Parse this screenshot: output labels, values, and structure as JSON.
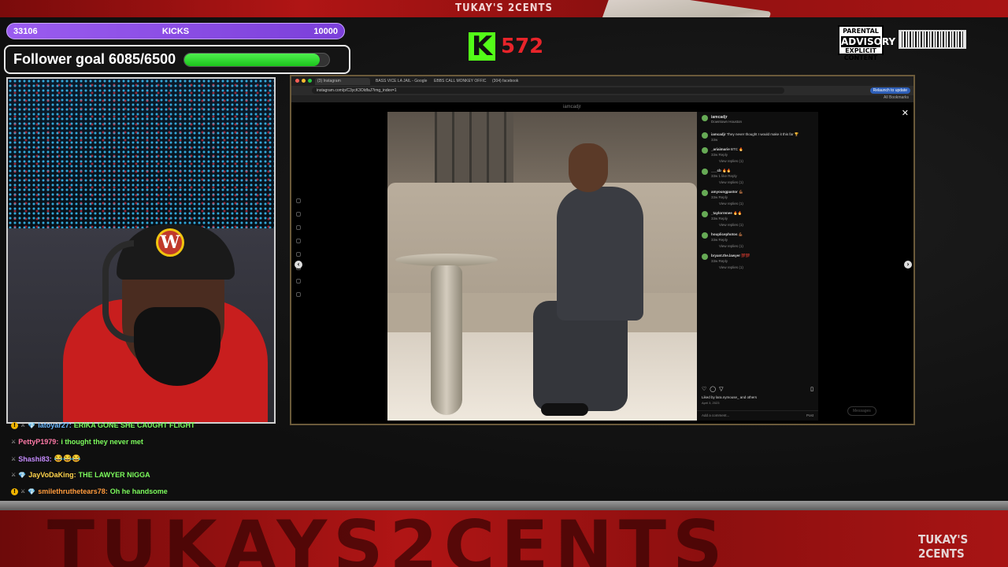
{
  "overlay": {
    "top_title": "TUKAY'S 2CENTS",
    "kicks_bar": {
      "left": "33106",
      "label": "KICKS",
      "right": "10000"
    },
    "follower_goal": {
      "label": "Follower goal 6085/6500",
      "current": 6085,
      "target": 6500
    },
    "kick_count": "572",
    "kick_logo": "K",
    "advisory": {
      "top": "PARENTAL",
      "big": "ADVISORY",
      "bottom": "EXPLICIT CONTENT"
    },
    "bottom_big_text": "TUKAYS2CENTS",
    "bottom_logo": "TUKAY'S 2CENTS",
    "colors": {
      "kick_green": "#53fc18",
      "brand_red": "#b01515",
      "kicks_purple": "#9b5cf0"
    }
  },
  "browser": {
    "tabs": [
      "(3) Instagram",
      "BASS VICE LA JAIL - Google",
      "EBBS CALL MONKEY OFFIC...",
      "(304) facebook"
    ],
    "url": "instagram.com/p/C3ycK3OldfaJ?img_index=1",
    "update_label": "Relaunch to update",
    "bookmarks_label": "All Bookmarks"
  },
  "instagram": {
    "top_username": "iamcadjr",
    "post_user": "iamcadjr",
    "post_location": "Downtown Houston",
    "caption_user": "iamcadjr",
    "caption": "They never thought I would make it this far 🏆",
    "caption_meta": "33w",
    "comments": [
      {
        "user": "_ariaimarie",
        "text": "BTC 🔥",
        "meta": "33w  Reply",
        "replies": "View replies (1)"
      },
      {
        "user": "___cb",
        "text": "🔥🔥",
        "meta": "33w  1 like  Reply",
        "replies": "View replies (1)"
      },
      {
        "user": "amyoungpastor",
        "text": "💪🏾",
        "meta": "33w  Reply",
        "replies": "View replies (1)"
      },
      {
        "user": "_taylorrenee",
        "text": "🔥🔥",
        "meta": "33w  Reply",
        "replies": "View replies (1)"
      },
      {
        "user": "houplicephotos",
        "text": "💪🏾",
        "meta": "33w  Reply",
        "replies": "View replies (1)"
      },
      {
        "user": "bryant.the.lawyer",
        "text": "💯💯",
        "meta": "33w  Reply",
        "replies": "View replies (1)"
      }
    ],
    "likes": "Liked by lara.nymouse_ and others",
    "date": "April 3, 2023",
    "add_comment": "Add a comment...",
    "post_button": "Post",
    "messages_label": "Messages",
    "close": "✕",
    "prev": "‹",
    "next": "›"
  },
  "chat": [
    {
      "badge": "!",
      "sword": "⚔",
      "gem": "💎",
      "user": "latoyar27:",
      "user_color": "#6bb8ff",
      "msg": "ERIKA GONE SHE CAUGHT FLIGHT",
      "msg_color": "#7cfc5c"
    },
    {
      "badge": "",
      "sword": "⚔",
      "gem": "",
      "user": "PettyP1979:",
      "user_color": "#ff7aa8",
      "msg": "i thought they never met",
      "msg_color": "#7cfc5c"
    },
    {
      "badge": "",
      "sword": "⚔",
      "gem": "",
      "user": "Shashi83:",
      "user_color": "#c58bff",
      "msg": "😂😂😂",
      "msg_color": "#7cfc5c"
    },
    {
      "badge": "",
      "sword": "⚔",
      "gem": "💎",
      "user": "JayVoDaKing:",
      "user_color": "#ffd34a",
      "msg": "THE LAWYER NIGGA",
      "msg_color": "#7cfc5c"
    },
    {
      "badge": "!",
      "sword": "⚔",
      "gem": "💎",
      "user": "smilethruthetears78:",
      "user_color": "#ff9a3c",
      "msg": "Oh he handsome",
      "msg_color": "#7cfc5c"
    }
  ]
}
